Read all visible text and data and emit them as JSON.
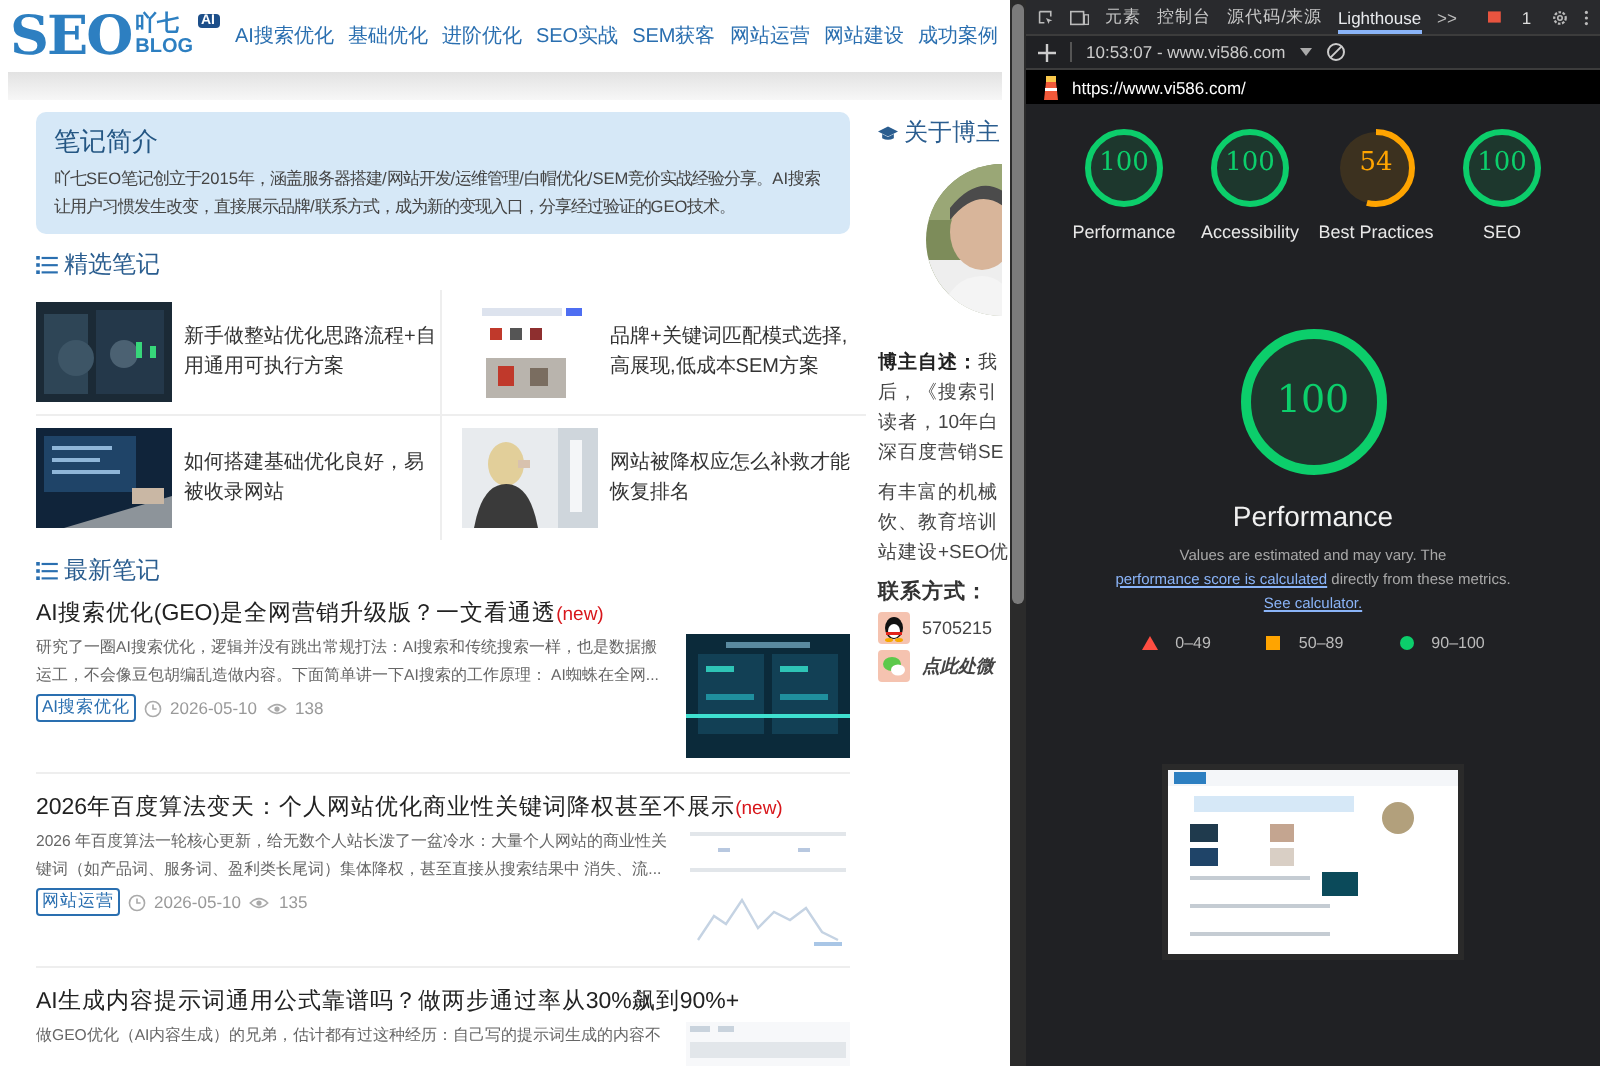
{
  "site": {
    "logo": {
      "main": "SEO",
      "cn": "吖七",
      "sub": "BLOG",
      "badge": "AI"
    },
    "nav": [
      "AI搜索优化",
      "基础优化",
      "进阶优化",
      "SEO实战",
      "SEM获客",
      "网站运营",
      "网站建设",
      "成功案例"
    ]
  },
  "intro": {
    "title": "笔记简介",
    "text": "吖七SEO笔记创立于2015年，涵盖服务器搭建/网站开发/运维管理/白帽优化/SEM竞价实战经验分享。AI搜索让用户习惯发生改变，直接展示品牌/联系方式，成为新的变现入口，分享经过验证的GEO技术。"
  },
  "featured": {
    "heading": "精选笔记",
    "items": [
      {
        "title": "新手做整站优化思路流程+自用通用可执行方案"
      },
      {
        "title": "品牌+关键词匹配模式选择,高展现,低成本SEM方案"
      },
      {
        "title": "如何搭建基础优化良好，易被收录网站"
      },
      {
        "title": "网站被降权应怎么补救才能恢复排名"
      }
    ]
  },
  "latest": {
    "heading": "最新笔记",
    "articles": [
      {
        "title": "AI搜索优化(GEO)是全网营销升级版？一文看通透",
        "badge": "(new)",
        "excerpt": "研究了一圈AI搜索优化，逻辑并没有跳出常规打法：AI搜索和传统搜索一样，也是数据搬运工，不会像豆包胡编乱造做内容。下面简单讲一下AI搜索的工作原理： AI蜘蛛在全网...",
        "tag": "AI搜索优化",
        "date": "2026-05-10",
        "views": "138"
      },
      {
        "title": "2026年百度算法变天：个人网站优化商业性关键词降权甚至不展示",
        "badge": "(new)",
        "excerpt": "2026 年百度算法一轮核心更新，给无数个人站长泼了一盆冷水：大量个人网站的商业性关键词（如产品词、服务词、盈利类长尾词）集体降权，甚至直接从搜索结果中 消失、流...",
        "tag": "网站运营",
        "date": "2026-05-10",
        "views": "135"
      },
      {
        "title": "AI生成内容提示词通用公式靠谱吗？做两步通过率从30%飙到90%+",
        "excerpt": "做GEO优化（AI内容生成）的兄弟，估计都有过这种经历：自己写的提示词生成的内容不"
      }
    ]
  },
  "sidebar": {
    "heading": "关于博主",
    "bio_lines": [
      "**博主自述：**我",
      "后，《搜索引",
      "读者，10年白",
      "深百度营销SE"
    ],
    "bio2_lines": [
      "有丰富的机械",
      "饮、教育培训",
      "站建设+SEO优"
    ],
    "contact_label": "联系方式：",
    "contacts": [
      {
        "kind": "qq",
        "text": "5705215"
      },
      {
        "kind": "wechat",
        "text": "点此处微"
      }
    ]
  },
  "devtools": {
    "tabs": [
      {
        "label": "元素",
        "selected": false
      },
      {
        "label": "控制台",
        "selected": false
      },
      {
        "label": "源代码/来源",
        "selected": false
      },
      {
        "label": "Lighthouse",
        "selected": true
      }
    ],
    "more": ">>",
    "issues": "1",
    "session": "10:53:07 - www.vi586.com",
    "url": "https://www.vi586.com/",
    "gauges": [
      {
        "label": "Performance",
        "score": "100",
        "level": 1,
        "color": "#0cce6b"
      },
      {
        "label": "Accessibility",
        "score": "100",
        "level": 1,
        "color": "#0cce6b"
      },
      {
        "label": "Best Practices",
        "score": "54",
        "level": 0.54,
        "color": "#ffa400"
      },
      {
        "label": "SEO",
        "score": "100",
        "level": 1,
        "color": "#0cce6b"
      }
    ],
    "main": {
      "score": "100",
      "level": 1,
      "color": "#0cce6b",
      "title": "Performance",
      "description": [
        {
          "kind": "text",
          "text": "Values are estimated and may vary. The "
        },
        {
          "kind": "link",
          "text": "performance score is calculated"
        },
        {
          "kind": "text",
          "text": " directly from these metrics. "
        },
        {
          "kind": "link",
          "text": "See calculator."
        }
      ]
    },
    "legend": [
      {
        "kind": "triangle",
        "color": "#ff4e42",
        "text": "0–49"
      },
      {
        "kind": "square",
        "color": "#ffa400",
        "text": "50–89"
      },
      {
        "kind": "dot",
        "color": "#0cce6b",
        "text": "90–100"
      }
    ]
  }
}
